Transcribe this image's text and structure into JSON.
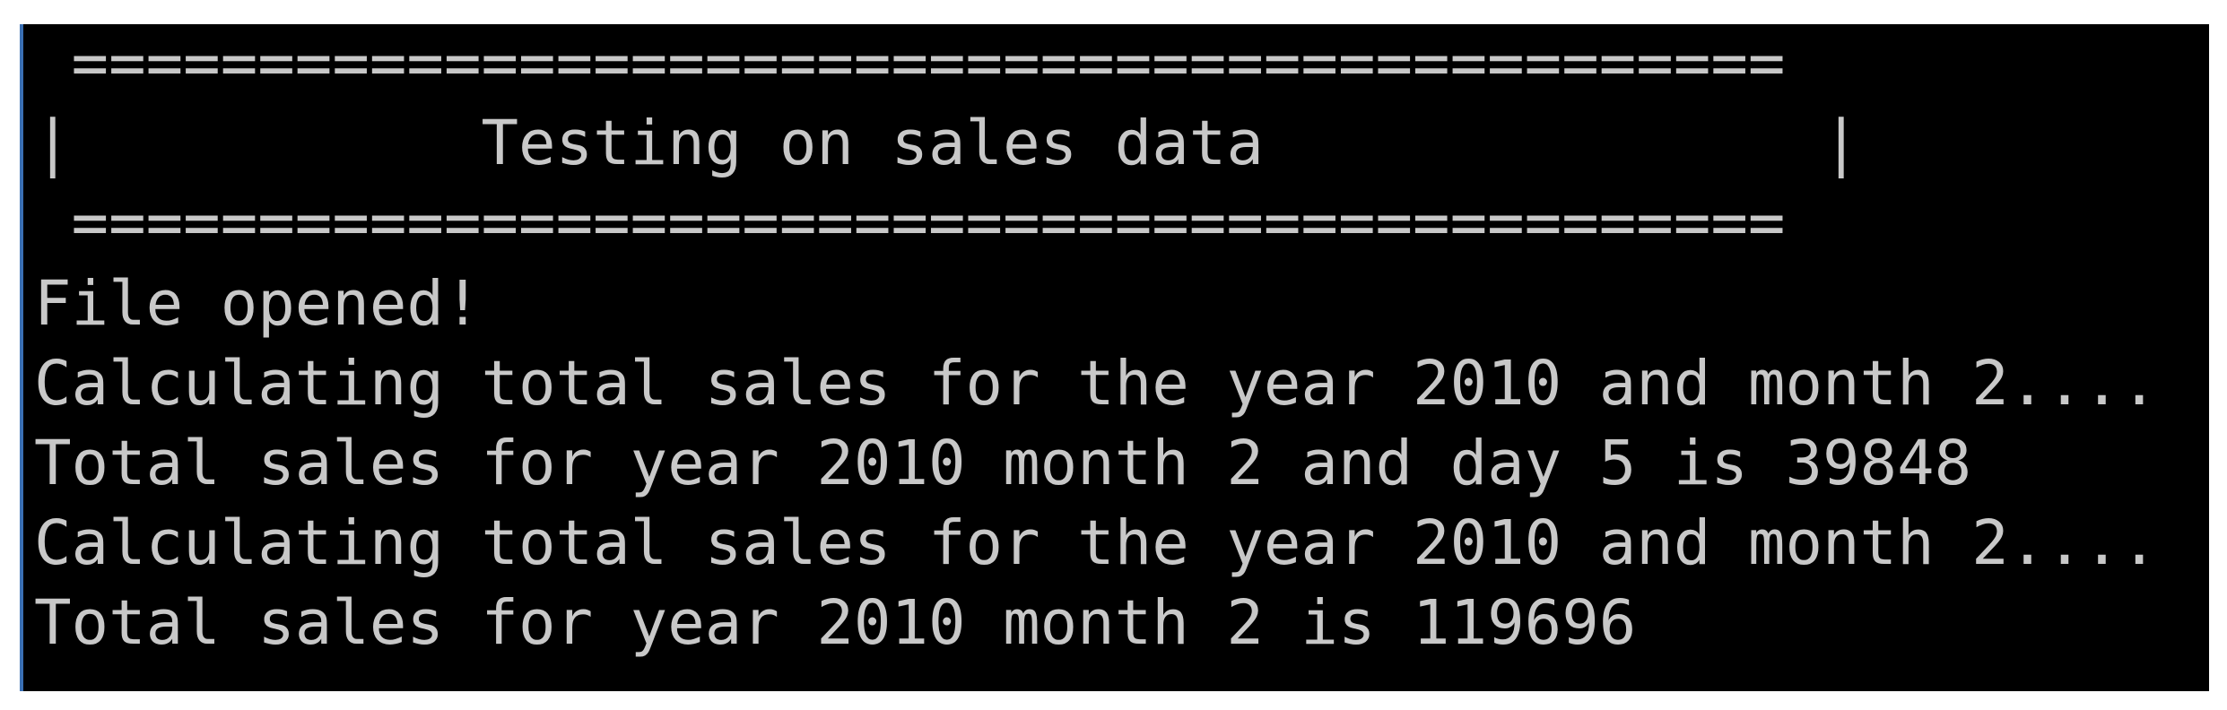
{
  "console": {
    "banner": {
      "rule_top": " ==============================================",
      "title_line": "|           Testing on sales data               |",
      "rule_bottom": " =============================================="
    },
    "output": [
      "File opened!",
      "Calculating total sales for the year 2010 and month 2....",
      "Total sales for year 2010 month 2 and day 5 is 39848",
      "Calculating total sales for the year 2010 and month 2....",
      "Total sales for year 2010 month 2 is 119696"
    ],
    "colors": {
      "background": "#000000",
      "text": "#c8c8c8",
      "left_border": "#3a6fb3"
    }
  }
}
